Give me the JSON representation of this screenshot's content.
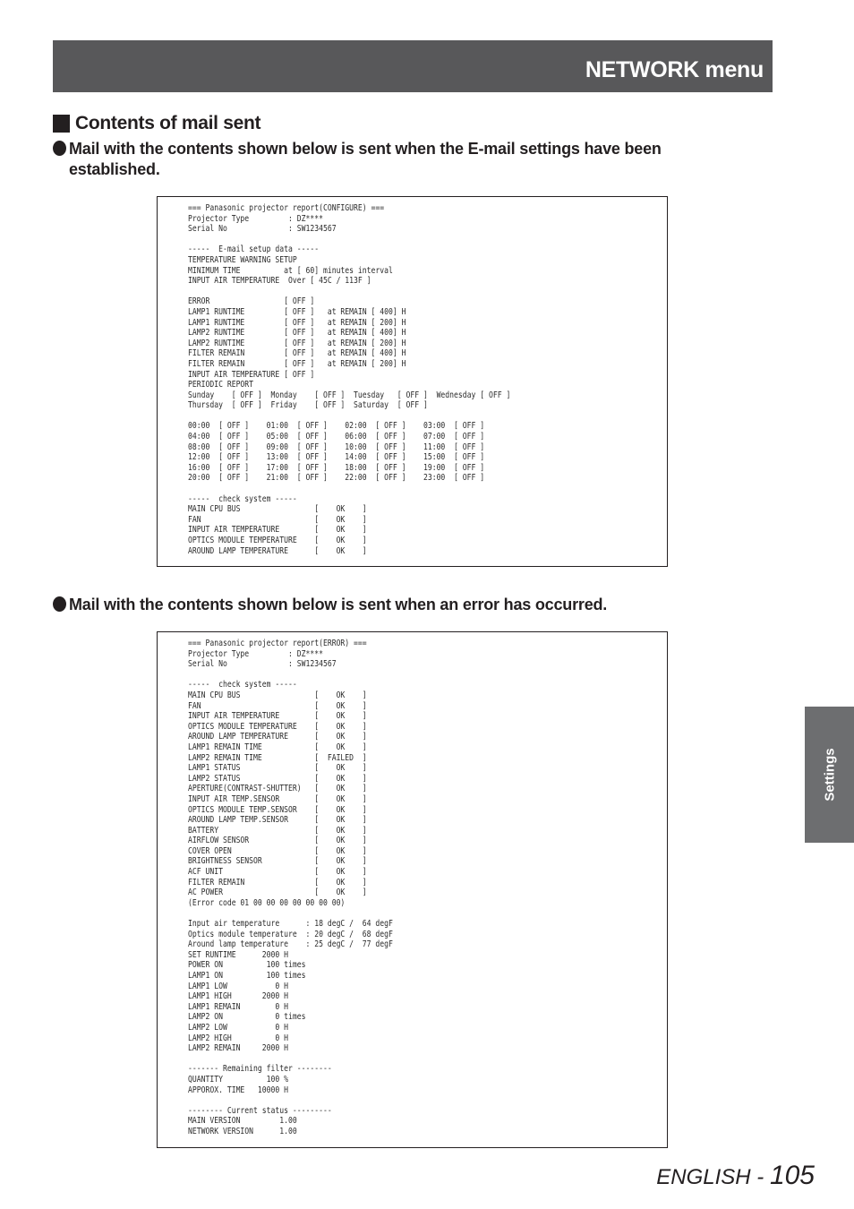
{
  "header": {
    "title": "NETWORK menu"
  },
  "section": {
    "title": "Contents of mail sent"
  },
  "paragraphs": {
    "configure_line1": "Mail with the contents shown below is sent when the E-mail settings have been",
    "configure_line2": "established.",
    "error": "Mail with the contents shown below is sent when an error has occurred."
  },
  "mail_configure": {
    "lines": [
      "=== Panasonic projector report(CONFIGURE) ===",
      "Projector Type         : DZ****",
      "Serial No              : SW1234567",
      "",
      "-----  E-mail setup data -----",
      "TEMPERATURE WARNING SETUP",
      "MINIMUM TIME          at [ 60] minutes interval",
      "INPUT AIR TEMPERATURE  Over [ 45C / 113F ]",
      "",
      "ERROR                 [ OFF ]",
      "LAMP1 RUNTIME         [ OFF ]   at REMAIN [ 400] H",
      "LAMP1 RUNTIME         [ OFF ]   at REMAIN [ 200] H",
      "LAMP2 RUNTIME         [ OFF ]   at REMAIN [ 400] H",
      "LAMP2 RUNTIME         [ OFF ]   at REMAIN [ 200] H",
      "FILTER REMAIN         [ OFF ]   at REMAIN [ 400] H",
      "FILTER REMAIN         [ OFF ]   at REMAIN [ 200] H",
      "INPUT AIR TEMPERATURE [ OFF ]",
      "PERIODIC REPORT",
      "Sunday    [ OFF ]  Monday    [ OFF ]  Tuesday   [ OFF ]  Wednesday [ OFF ]",
      "Thursday  [ OFF ]  Friday    [ OFF ]  Saturday  [ OFF ]",
      "",
      "00:00  [ OFF ]    01:00  [ OFF ]    02:00  [ OFF ]    03:00  [ OFF ]",
      "04:00  [ OFF ]    05:00  [ OFF ]    06:00  [ OFF ]    07:00  [ OFF ]",
      "08:00  [ OFF ]    09:00  [ OFF ]    10:00  [ OFF ]    11:00  [ OFF ]",
      "12:00  [ OFF ]    13:00  [ OFF ]    14:00  [ OFF ]    15:00  [ OFF ]",
      "16:00  [ OFF ]    17:00  [ OFF ]    18:00  [ OFF ]    19:00  [ OFF ]",
      "20:00  [ OFF ]    21:00  [ OFF ]    22:00  [ OFF ]    23:00  [ OFF ]",
      "",
      "-----  check system -----",
      "MAIN CPU BUS                 [    OK    ]",
      "FAN                          [    OK    ]",
      "INPUT AIR TEMPERATURE        [    OK    ]",
      "OPTICS MODULE TEMPERATURE    [    OK    ]",
      "AROUND LAMP TEMPERATURE      [    OK    ]"
    ]
  },
  "mail_error": {
    "lines": [
      "=== Panasonic projector report(ERROR) ===",
      "Projector Type         : DZ****",
      "Serial No              : SW1234567",
      "",
      "-----  check system -----",
      "MAIN CPU BUS                 [    OK    ]",
      "FAN                          [    OK    ]",
      "INPUT AIR TEMPERATURE        [    OK    ]",
      "OPTICS MODULE TEMPERATURE    [    OK    ]",
      "AROUND LAMP TEMPERATURE      [    OK    ]",
      "LAMP1 REMAIN TIME            [    OK    ]",
      "LAMP2 REMAIN TIME            [  FAILED  ]",
      "LAMP1 STATUS                 [    OK    ]",
      "LAMP2 STATUS                 [    OK    ]",
      "APERTURE(CONTRAST-SHUTTER)   [    OK    ]",
      "INPUT AIR TEMP.SENSOR        [    OK    ]",
      "OPTICS MODULE TEMP.SENSOR    [    OK    ]",
      "AROUND LAMP TEMP.SENSOR      [    OK    ]",
      "BATTERY                      [    OK    ]",
      "AIRFLOW SENSOR               [    OK    ]",
      "COVER OPEN                   [    OK    ]",
      "BRIGHTNESS SENSOR            [    OK    ]",
      "ACF UNIT                     [    OK    ]",
      "FILTER REMAIN                [    OK    ]",
      "AC POWER                     [    OK    ]",
      "(Error code 01 00 00 00 00 00 00 00)",
      "",
      "Input air temperature      : 18 degC /  64 degF",
      "Optics module temperature  : 20 degC /  68 degF",
      "Around lamp temperature    : 25 degC /  77 degF",
      "SET RUNTIME      2000 H",
      "POWER ON          100 times",
      "LAMP1 ON          100 times",
      "LAMP1 LOW           0 H",
      "LAMP1 HIGH       2000 H",
      "LAMP1 REMAIN        0 H",
      "LAMP2 ON            0 times",
      "LAMP2 LOW           0 H",
      "LAMP2 HIGH          0 H",
      "LAMP2 REMAIN     2000 H",
      "",
      "------- Remaining filter --------",
      "QUANTITY          100 %",
      "APPOROX. TIME   10000 H",
      "",
      "-------- Current status ---------",
      "MAIN VERSION         1.00",
      "NETWORK VERSION      1.00"
    ]
  },
  "side_tab": {
    "label": "Settings"
  },
  "footer": {
    "language": "ENGLISH - ",
    "page_number": "105"
  }
}
